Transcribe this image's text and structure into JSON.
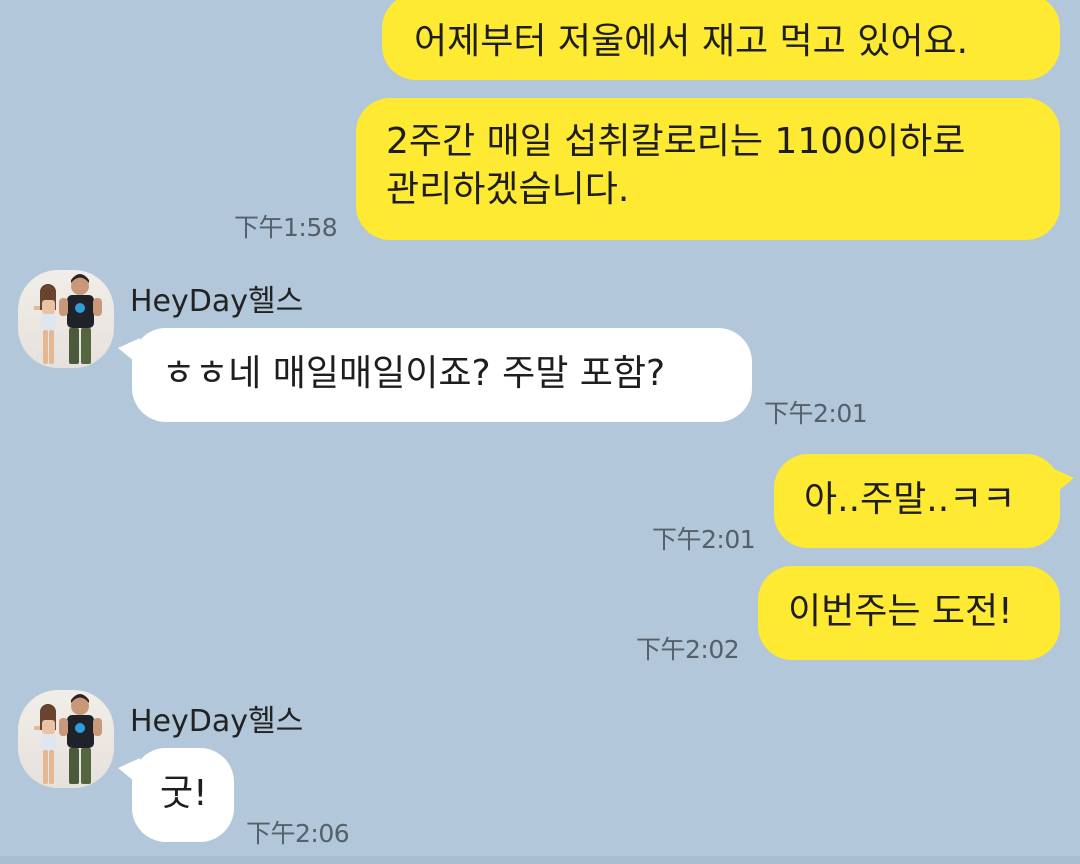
{
  "messages": [
    {
      "side": "mine",
      "lines": [
        "어제부터 저울에서 재고 먹고 있어요."
      ],
      "time": ""
    },
    {
      "side": "mine",
      "lines": [
        "2주간 매일 섭취칼로리는 1100이하로",
        "관리하겠습니다."
      ],
      "time": "下午1:58"
    },
    {
      "side": "theirs",
      "sender": "HeyDay헬스",
      "lines": [
        "ㅎㅎ네 매일매일이죠? 주말 포함?"
      ],
      "time": "下午2:01"
    },
    {
      "side": "mine",
      "lines": [
        "아..주말..ㅋㅋ"
      ],
      "time": "下午2:01"
    },
    {
      "side": "mine",
      "lines": [
        "이번주는 도전!"
      ],
      "time": "下午2:02"
    },
    {
      "side": "theirs",
      "sender": "HeyDay헬스",
      "lines": [
        "굿!"
      ],
      "time": "下午2:06"
    }
  ],
  "avatar_icon": "profile-photo-icon",
  "colors": {
    "background": "#b2c7d9",
    "my_bubble": "#fee933",
    "their_bubble": "#ffffff",
    "timestamp": "#55606b"
  }
}
